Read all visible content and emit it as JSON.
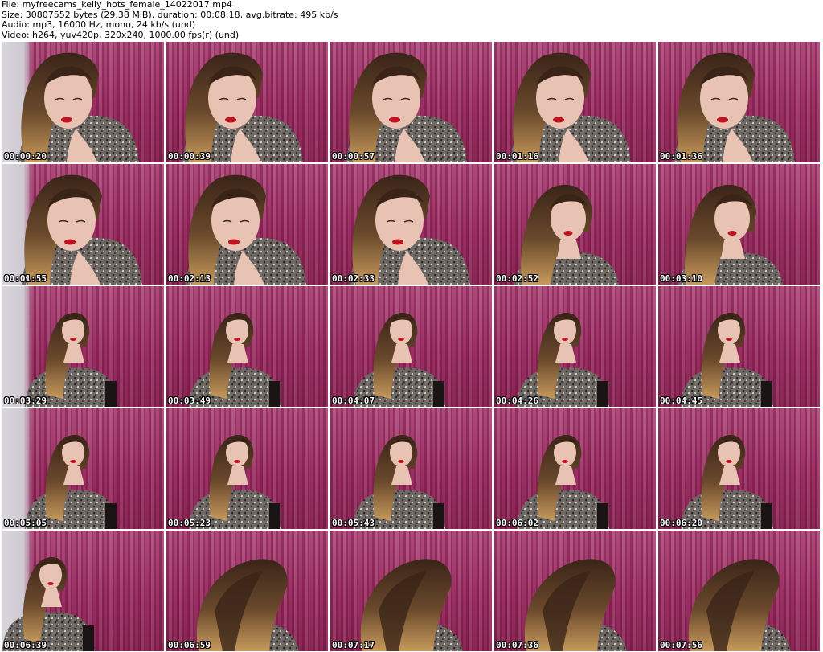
{
  "header": {
    "file_line": "File: myfreecams_kelly_hots_female_14022017.mp4",
    "size_line": "Size: 30807552 bytes (29.38 MiB), duration: 00:08:18, avg.bitrate: 495 kb/s",
    "audio_line": "Audio: mp3, 16000 Hz, mono, 24 kb/s (und)",
    "video_line": "Video: h264, yuv420p, 320x240, 1000.00 fps(r) (und)"
  },
  "colors": {
    "curtain": "#9b2e63",
    "hair": "#3a2418",
    "skin": "#e8c3b4",
    "lips": "#c0121e",
    "top": "#6f6a66"
  },
  "thumbnails": [
    {
      "time": "00:00:20",
      "pose": "close-down"
    },
    {
      "time": "00:00:39",
      "pose": "close-down"
    },
    {
      "time": "00:00:57",
      "pose": "close-down"
    },
    {
      "time": "00:01:16",
      "pose": "close-down"
    },
    {
      "time": "00:01:36",
      "pose": "close-down"
    },
    {
      "time": "00:01:55",
      "pose": "close-tilt"
    },
    {
      "time": "00:02:13",
      "pose": "close-tilt"
    },
    {
      "time": "00:02:33",
      "pose": "close-tilt"
    },
    {
      "time": "00:02:52",
      "pose": "mid-down"
    },
    {
      "time": "00:03:10",
      "pose": "mid-smile"
    },
    {
      "time": "00:03:29",
      "pose": "far"
    },
    {
      "time": "00:03:49",
      "pose": "far"
    },
    {
      "time": "00:04:07",
      "pose": "far"
    },
    {
      "time": "00:04:26",
      "pose": "far"
    },
    {
      "time": "00:04:45",
      "pose": "far"
    },
    {
      "time": "00:05:05",
      "pose": "far"
    },
    {
      "time": "00:05:23",
      "pose": "far"
    },
    {
      "time": "00:05:43",
      "pose": "far"
    },
    {
      "time": "00:06:02",
      "pose": "far"
    },
    {
      "time": "00:06:20",
      "pose": "far"
    },
    {
      "time": "00:06:39",
      "pose": "far-left"
    },
    {
      "time": "00:06:59",
      "pose": "hair-back"
    },
    {
      "time": "00:07:17",
      "pose": "hair-back"
    },
    {
      "time": "00:07:36",
      "pose": "hair-back"
    },
    {
      "time": "00:07:56",
      "pose": "hair-back"
    }
  ]
}
